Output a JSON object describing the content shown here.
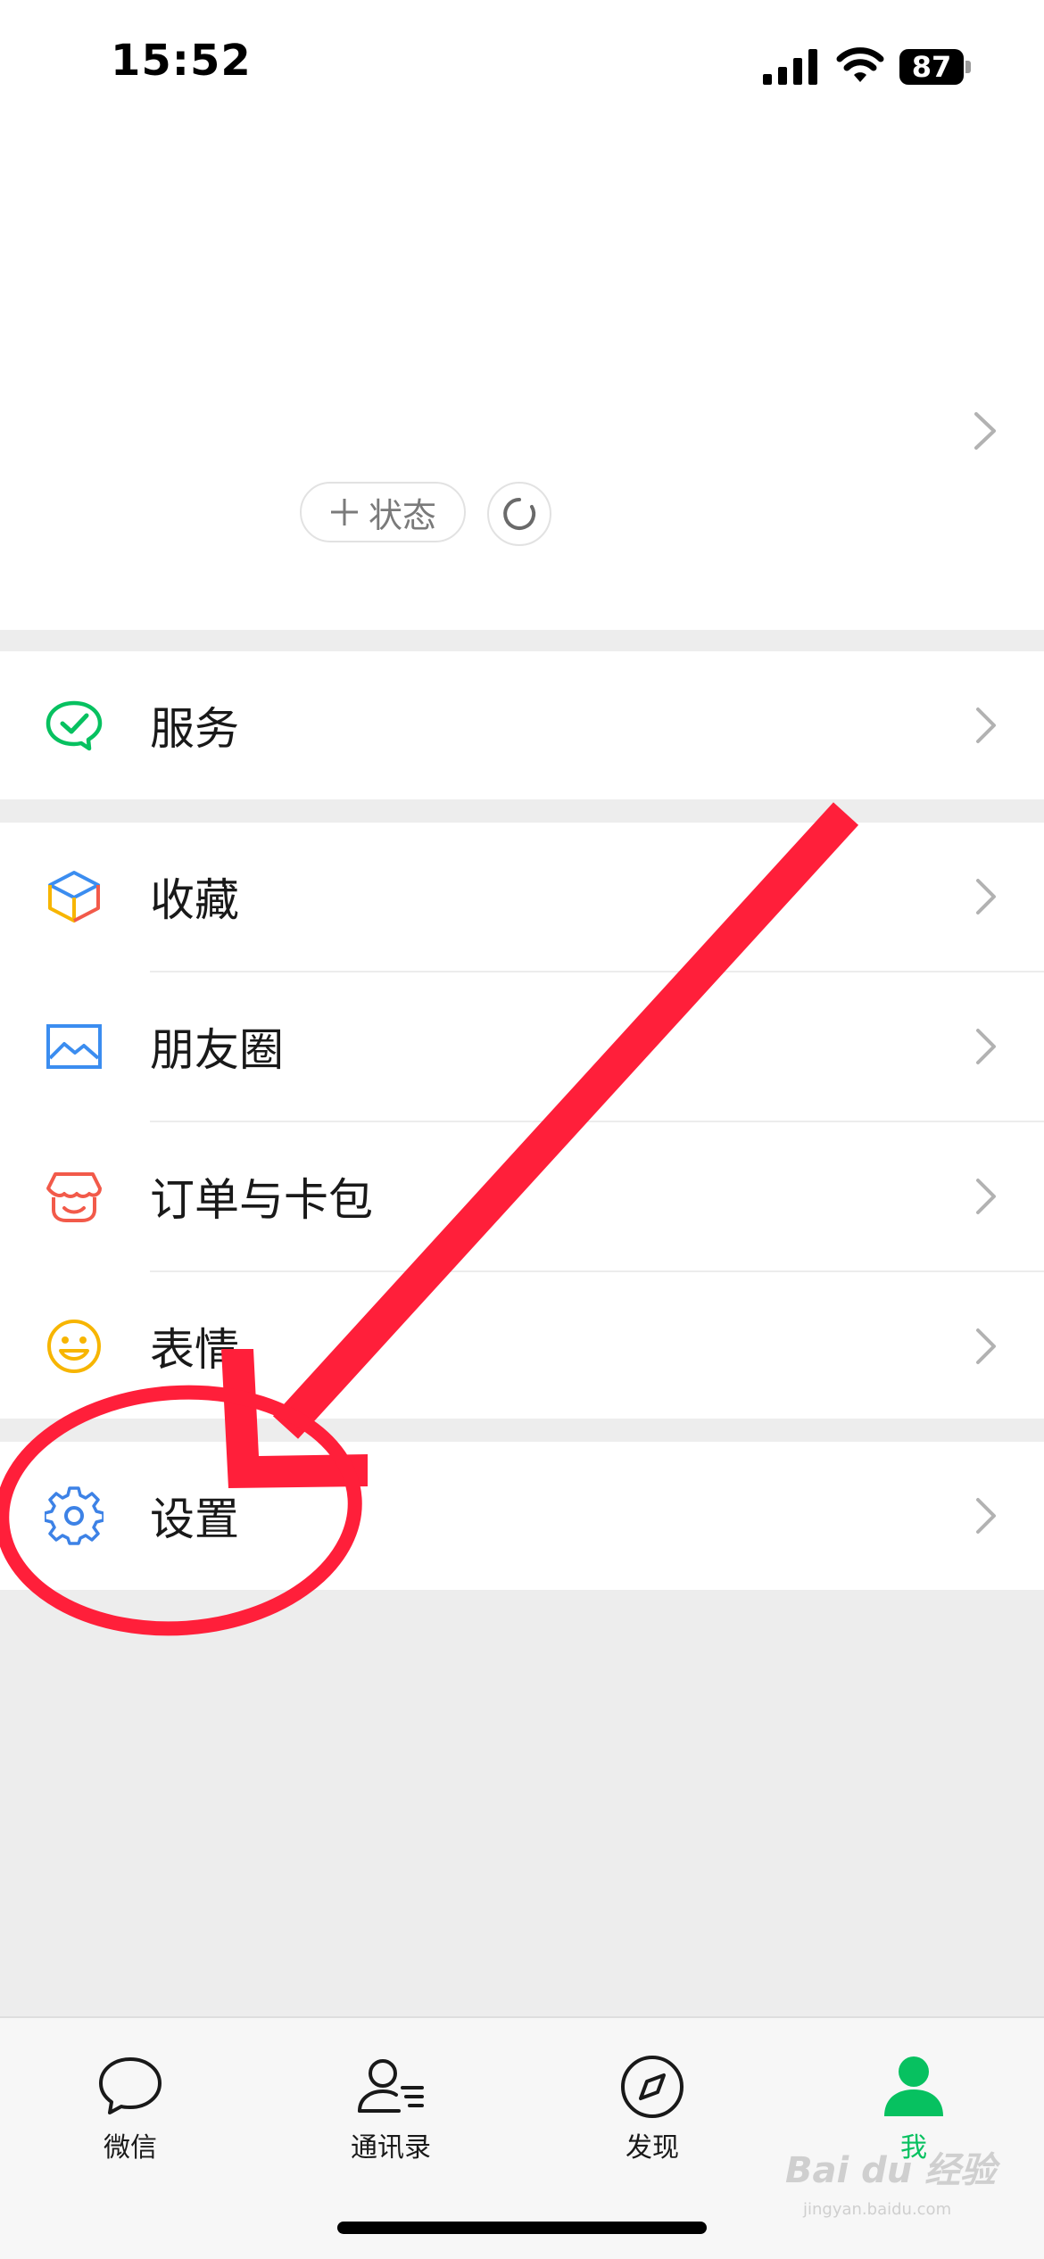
{
  "status_bar": {
    "time": "15:52",
    "battery": "87"
  },
  "profile": {
    "status_button_label": "状态"
  },
  "menu": {
    "service": "服务",
    "favorites": "收藏",
    "moments": "朋友圈",
    "orders_cards": "订单与卡包",
    "stickers": "表情",
    "settings": "设置"
  },
  "tabbar": {
    "chats": "微信",
    "contacts": "通讯录",
    "discover": "发现",
    "me": "我",
    "active": "me"
  },
  "colors": {
    "wechat_green": "#07c160",
    "annotation_red": "#ff1f3a",
    "favorites_blue": "#3b8df0",
    "orders_red": "#f25a4a",
    "stickers_yellow": "#f7b500",
    "settings_blue": "#3d82e6"
  },
  "watermark": {
    "brand": "Bai du 经验",
    "url": "jingyan.baidu.com"
  }
}
